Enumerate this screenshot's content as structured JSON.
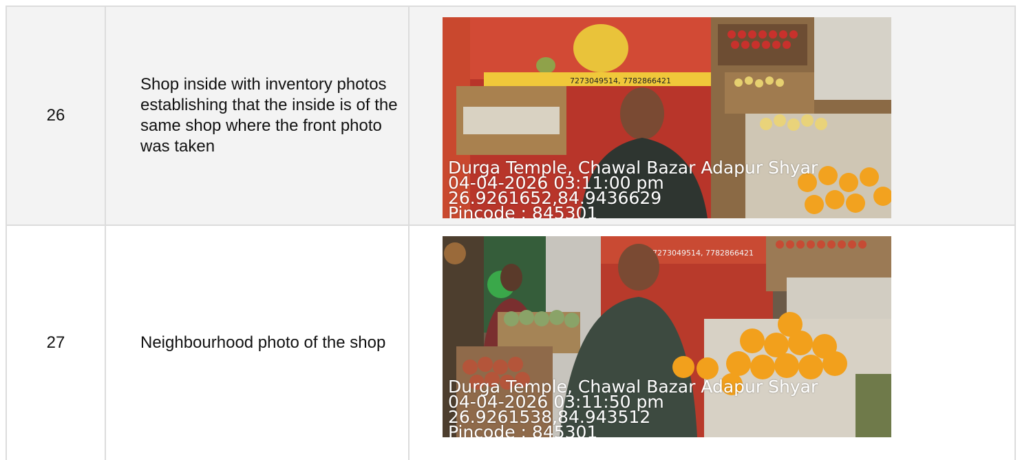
{
  "rows": [
    {
      "number": "26",
      "description": "Shop inside with inventory photos establishing that the inside is of the same shop where the front photo was taken",
      "photo": {
        "stamp_lines": [
          "Durga Temple, Chawal Bazar Adapur Shyar",
          "04-04-2026 03:11:00 pm",
          "26.9261652,84.9436629",
          "Pincode : 845301"
        ],
        "sign_text": "7273049514, 7782866421"
      }
    },
    {
      "number": "27",
      "description": "Neighbourhood photo of the shop",
      "photo": {
        "stamp_lines": [
          "Durga Temple, Chawal Bazar Adapur Shyar",
          "04-04-2026 03:11:50 pm",
          "26.9261538,84.943512",
          "Pincode : 845301"
        ],
        "sign_text": "7273049514, 7782866421"
      }
    }
  ]
}
